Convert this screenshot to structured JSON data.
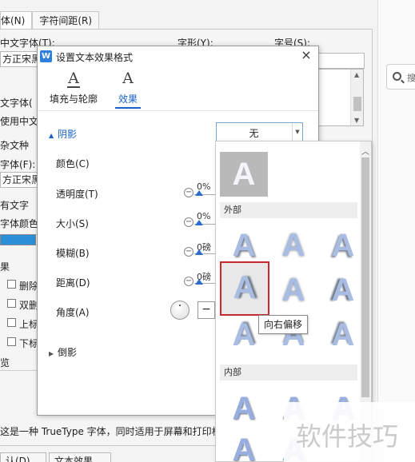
{
  "background_dialog": {
    "tabs": [
      "体(N)",
      "字符间距(R)"
    ],
    "labels": {
      "cn_font": "中文字体(T):",
      "style": "字形(Y):",
      "size": "字号(S):",
      "cn_font_value": "方正宋黑",
      "west_font": "文字体(",
      "use_cn": "使用中文",
      "complex": "杂文种",
      "font_f": "字体(F):",
      "font_f_value": "方正宋黑",
      "all_text": "有文字",
      "font_color": "字体颜色(",
      "effects": "果",
      "strike": "删除线",
      "double_strike": "双删除",
      "superscript": "上标(P",
      "subscript": "下标(B",
      "preview": "览",
      "footnote": "这是一种 TrueType 字体，同时适用于屏幕和打印机",
      "default_btn": "认(D)...",
      "text_effect_btn": "文本效果(E)..."
    },
    "side_search": "搜"
  },
  "dialog": {
    "title": "设置文本效果格式",
    "app_icon": "W",
    "close_icon": "×",
    "tabs": [
      {
        "glyph": "A",
        "label": "填充与轮廓"
      },
      {
        "glyph": "A",
        "label": "效果"
      }
    ],
    "shadow": {
      "heading": "阴影",
      "preset_value": "无",
      "color_label": "颜色(C)",
      "transparency_label": "透明度(T)",
      "transparency_value": "0%",
      "size_label": "大小(S)",
      "size_value": "0%",
      "blur_label": "模糊(B)",
      "blur_value": "0磅",
      "distance_label": "距离(D)",
      "distance_value": "0磅",
      "angle_label": "角度(A)",
      "angle_btn": "−"
    },
    "reflection": {
      "heading": "倒影"
    }
  },
  "gallery": {
    "none_tile": "A",
    "outer_heading": "外部",
    "inner_heading": "内部",
    "tile_letter": "A",
    "tooltip": "向右偏移"
  },
  "watermark": "软件技巧",
  "colors": {
    "accent": "#1a62c8",
    "hover_border": "#c8282f",
    "font_color_swatch": "#2b8fd6"
  }
}
